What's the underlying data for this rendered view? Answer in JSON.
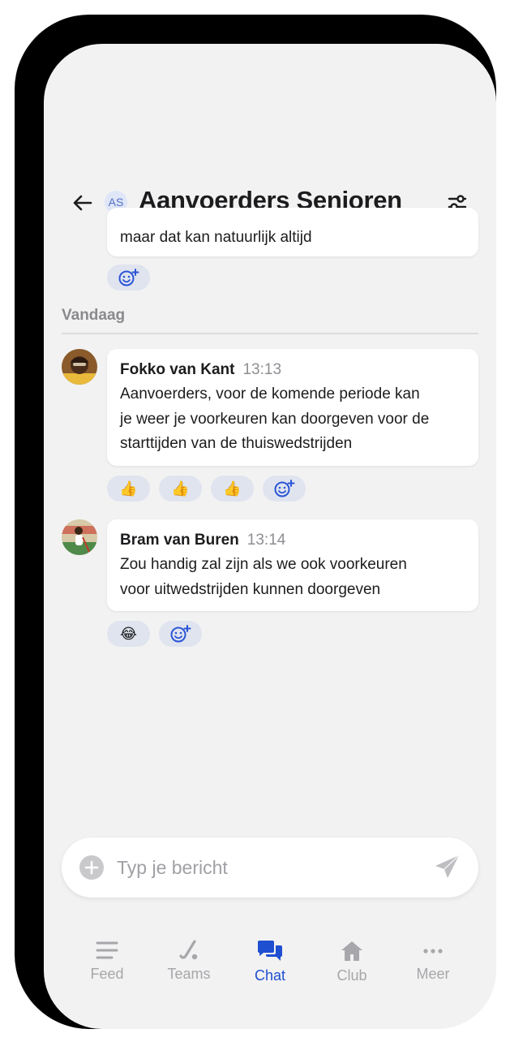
{
  "header": {
    "title": "Aanvoerders Senioren",
    "group_initials": "AS"
  },
  "previous_message": {
    "text_fragment": "maar dat kan natuurlijk altijd"
  },
  "date_divider": "Vandaag",
  "messages": [
    {
      "author": "Fokko van Kant",
      "time": "13:13",
      "lines": [
        "Aanvoerders, voor de komende periode kan",
        "je weer je voorkeuren kan doorgeven voor de",
        "starttijden van de thuiswedstrijden"
      ],
      "reactions": [
        "👍",
        "👍",
        "👍"
      ]
    },
    {
      "author": "Bram van Buren",
      "time": "13:14",
      "lines": [
        "Zou handig zal zijn als we ook voorkeuren",
        "voor uitwedstrijden kunnen doorgeven"
      ],
      "reactions": [
        "😂"
      ]
    }
  ],
  "composer": {
    "placeholder": "Typ je bericht"
  },
  "tabbar": {
    "tabs": [
      {
        "label": "Feed",
        "icon": "feed-icon",
        "active": false
      },
      {
        "label": "Teams",
        "icon": "hockey-stick-icon",
        "active": false
      },
      {
        "label": "Chat",
        "icon": "chat-icon",
        "active": true
      },
      {
        "label": "Club",
        "icon": "home-icon",
        "active": false
      },
      {
        "label": "Meer",
        "icon": "more-icon",
        "active": false
      }
    ]
  },
  "colors": {
    "accent": "#1f4fd1",
    "reaction_bg": "#dfe4ef",
    "inactive_tab": "#a7a7ab"
  }
}
